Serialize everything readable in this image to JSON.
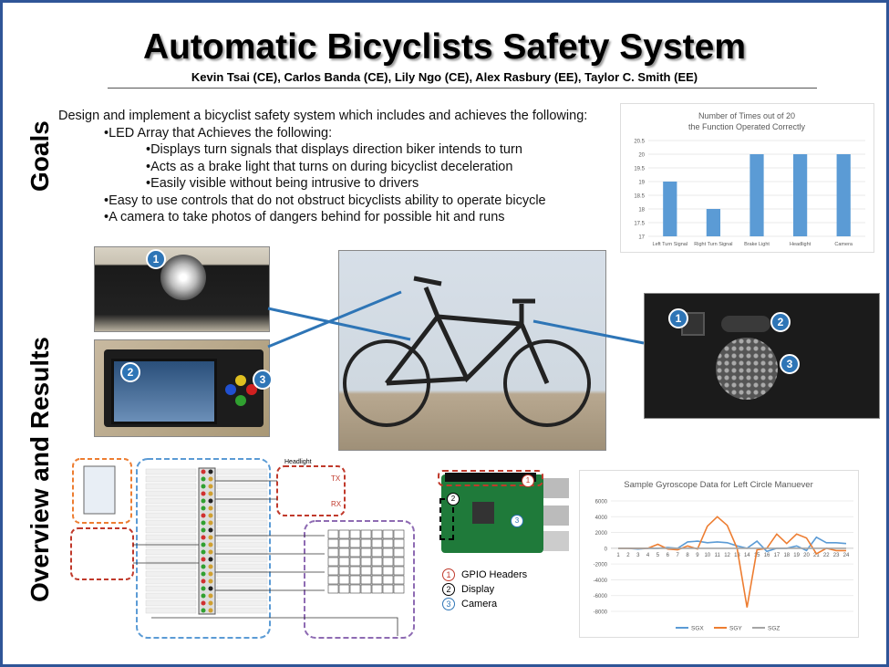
{
  "title": "Automatic Bicyclists Safety System",
  "authors": "Kevin Tsai (CE), Carlos Banda (CE), Lily Ngo (CE), Alex Rasbury (EE), Taylor C. Smith (EE)",
  "side_labels": {
    "goals": "Goals",
    "overview": "Overview and Results"
  },
  "goals": {
    "intro": "Design and implement a bicyclist safety system which includes and achieves the following:",
    "items": [
      "•LED Array that Achieves the following:",
      "•Displays turn signals that displays direction biker intends to turn",
      "•Acts as a brake light that turns on during bicyclist deceleration",
      "•Easily visible without being intrusive to drivers",
      "•Easy to use controls that do not obstruct bicyclists ability to operate bicycle",
      "•A camera to take photos of dangers behind for possible hit and runs"
    ]
  },
  "chart_data": [
    {
      "type": "bar",
      "title": "Number of Times out of 20 the Function Operated Correctly",
      "categories": [
        "Left Turn Signal",
        "Right Turn Signal",
        "Brake Light",
        "Headlight",
        "Camera"
      ],
      "values": [
        19,
        18,
        20,
        20,
        20
      ],
      "ylim": [
        17,
        20.5
      ],
      "yticks": [
        "17",
        "17.5",
        "18",
        "18.5",
        "19",
        "19.5",
        "20",
        "20.5"
      ],
      "color": "#5b9bd5"
    },
    {
      "type": "line",
      "title": "Sample Gyroscope Data for Left Circle Manuever",
      "x": [
        1,
        2,
        3,
        4,
        5,
        6,
        7,
        8,
        9,
        10,
        11,
        12,
        13,
        14,
        15,
        16,
        17,
        18,
        19,
        20,
        21,
        22,
        23,
        24
      ],
      "ylim": [
        -8000,
        6000
      ],
      "yticks": [
        "6000",
        "4000",
        "2000",
        "0",
        "-2000",
        "-4000",
        "-6000",
        "-8000"
      ],
      "series": [
        {
          "name": "SGX",
          "color": "#5b9bd5",
          "values": [
            0,
            0,
            -100,
            0,
            0,
            100,
            0,
            800,
            900,
            700,
            800,
            700,
            300,
            0,
            900,
            -400,
            0,
            0,
            300,
            -300,
            1400,
            700,
            700,
            600
          ]
        },
        {
          "name": "SGY",
          "color": "#ed7d31",
          "values": [
            0,
            0,
            0,
            0,
            500,
            -100,
            -200,
            300,
            -100,
            2800,
            4000,
            2900,
            0,
            -7500,
            -200,
            0,
            1800,
            600,
            1800,
            1300,
            -700,
            0,
            -300,
            -300
          ]
        },
        {
          "name": "SGZ",
          "color": "#a5a5a5",
          "values": [
            0,
            0,
            0,
            0,
            0,
            0,
            0,
            0,
            0,
            0,
            0,
            0,
            0,
            0,
            0,
            0,
            0,
            0,
            0,
            0,
            0,
            0,
            0,
            0
          ]
        }
      ]
    }
  ],
  "photo_numbers": [
    "1",
    "2",
    "3"
  ],
  "pi_legend": [
    {
      "num": "1",
      "label": "GPIO Headers",
      "color": "#c0392b"
    },
    {
      "num": "2",
      "label": "Display",
      "color": "#000000"
    },
    {
      "num": "3",
      "label": "Camera",
      "color": "#2e75b6"
    }
  ],
  "schematic": {
    "headlight": "Headlight",
    "tx": "TX",
    "rx": "RX"
  }
}
